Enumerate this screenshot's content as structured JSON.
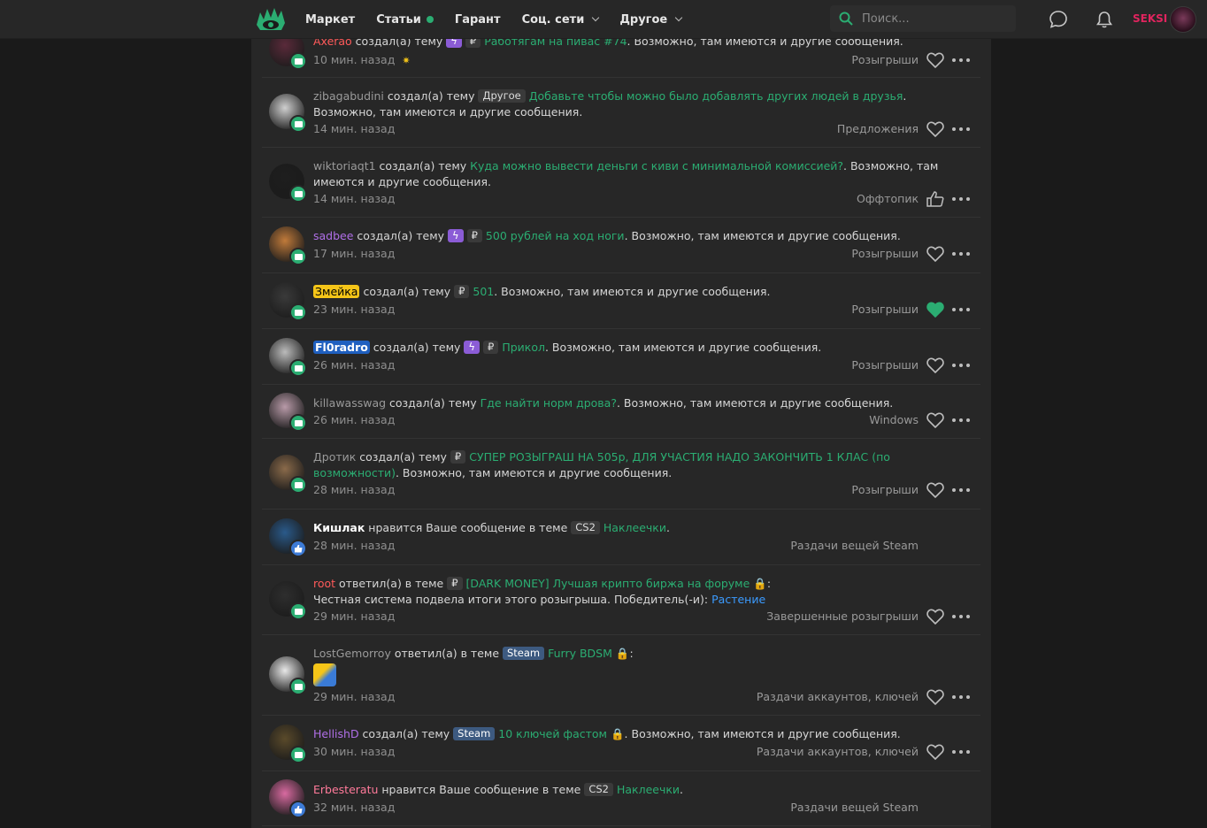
{
  "header": {
    "nav": [
      {
        "label": "Маркет",
        "dot": false,
        "dropdown": false
      },
      {
        "label": "Статьи",
        "dot": true,
        "dropdown": false
      },
      {
        "label": "Гарант",
        "dot": false,
        "dropdown": false
      },
      {
        "label": "Соц. сети",
        "dot": false,
        "dropdown": true
      },
      {
        "label": "Другое",
        "dot": false,
        "dropdown": true
      }
    ],
    "search_placeholder": "Поиск...",
    "username": "SEKSI"
  },
  "alerts": [
    {
      "user": "Axerao",
      "user_style": "red",
      "action": "создал(а) тему",
      "prefixes": [
        "bolt",
        "₽"
      ],
      "title": "Работягам на пивас #74",
      "suffix": ". Возможно, там имеются и другие сообщения.",
      "time": "10 мин. назад",
      "star": true,
      "forum": "Розыгрыши",
      "type": "msg",
      "reaction": "heart"
    },
    {
      "user": "zibagabudini",
      "user_style": "gray",
      "action": "создал(а) тему",
      "prefixes": [
        "Другое"
      ],
      "title": "Добавьте чтобы можно было добавлять других людей в друзья",
      "suffix": ". Возможно, там имеются и другие сообщения.",
      "time": "14 мин. назад",
      "forum": "Предложения",
      "type": "msg",
      "reaction": "heart"
    },
    {
      "user": "wiktoriaqt1",
      "user_style": "gray",
      "action": "создал(а) тему",
      "prefixes": [],
      "title": "Куда можно вывести деньги с киви с минимальной комиссией?",
      "suffix": ". Возможно, там имеются и другие сообщения.",
      "time": "14 мин. назад",
      "forum": "Оффтопик",
      "type": "msg",
      "reaction": "like"
    },
    {
      "user": "sadbee",
      "user_style": "purple",
      "action": "создал(а) тему",
      "prefixes": [
        "bolt",
        "₽"
      ],
      "title": "500 рублей на ход ноги",
      "suffix": ". Возможно, там имеются и другие сообщения.",
      "time": "17 мин. назад",
      "forum": "Розыгрыши",
      "type": "msg",
      "reaction": "heart"
    },
    {
      "user": "Змейка",
      "user_style": "yellow",
      "action": "создал(а) тему",
      "prefixes": [
        "₽"
      ],
      "title": "501",
      "suffix": ". Возможно, там имеются и другие сообщения.",
      "time": "23 мин. назад",
      "forum": "Розыгрыши",
      "type": "msg",
      "reaction": "heart-filled"
    },
    {
      "user": "Fl0radro",
      "user_style": "blue",
      "action": "создал(а) тему",
      "prefixes": [
        "bolt",
        "₽"
      ],
      "title": "Прикол",
      "suffix": ". Возможно, там имеются и другие сообщения.",
      "time": "26 мин. назад",
      "forum": "Розыгрыши",
      "type": "msg",
      "reaction": "heart"
    },
    {
      "user": "killawasswag",
      "user_style": "gray",
      "action": "создал(а) тему",
      "prefixes": [],
      "title": "Где найти норм дрова?",
      "suffix": ". Возможно, там имеются и другие сообщения.",
      "time": "26 мин. назад",
      "forum": "Windows",
      "type": "msg",
      "reaction": "heart"
    },
    {
      "user": "Дротик",
      "user_style": "gray",
      "action": "создал(а) тему",
      "prefixes": [
        "₽"
      ],
      "title": "СУПЕР РОЗЫГРАШ НА 505р, ДЛЯ УЧАСТИЯ НАДО ЗАКОНЧИТЬ 1 КЛАС (по возможности)",
      "suffix": ". Возможно, там имеются и другие сообщения.",
      "time": "28 мин. назад",
      "forum": "Розыгрыши",
      "type": "msg",
      "reaction": "heart"
    },
    {
      "user": "Кишлак",
      "user_style": "white",
      "action": "нравится Ваше сообщение в теме",
      "prefixes": [
        "CS2"
      ],
      "title": "Наклеечки",
      "suffix": ".",
      "time": "28 мин. назад",
      "forum": "Раздачи вещей Steam",
      "type": "like",
      "reaction": "none"
    },
    {
      "user": "root",
      "user_style": "red",
      "action": "ответил(а) в теме",
      "prefixes": [
        "₽"
      ],
      "title": "[DARK MONEY] Лучшая крипто биржа на форуме",
      "lock": true,
      "suffix": ":",
      "body": "Честная система подвела итоги этого розыгрыша. Победитель(-и): ",
      "body_link": "Растение",
      "time": "29 мин. назад",
      "forum": "Завершенные розыгрыши",
      "type": "msg",
      "reaction": "heart"
    },
    {
      "user": "LostGemorroy",
      "user_style": "gray",
      "action": "ответил(а) в теме",
      "prefixes": [
        "Steam"
      ],
      "title": "Furry BDSM",
      "lock": true,
      "suffix": ":",
      "emoji": true,
      "time": "29 мин. назад",
      "forum": "Раздачи аккаунтов, ключей",
      "type": "msg",
      "reaction": "heart"
    },
    {
      "user": "HellishD",
      "user_style": "purple",
      "action": "создал(а) тему",
      "prefixes": [
        "Steam"
      ],
      "title": "10 ключей фастом",
      "lock": true,
      "suffix": ". Возможно, там имеются и другие сообщения.",
      "time": "30 мин. назад",
      "forum": "Раздачи аккаунтов, ключей",
      "type": "msg",
      "reaction": "heart"
    },
    {
      "user": "Erbesteratu",
      "user_style": "pink",
      "action": "нравится Ваше сообщение в теме",
      "prefixes": [
        "CS2"
      ],
      "title": "Наклеечки",
      "suffix": ".",
      "time": "32 мин. назад",
      "forum": "Раздачи вещей Steam",
      "type": "like",
      "reaction": "none"
    }
  ],
  "colors": {
    "accent": "#2bad72",
    "background": "#1a1a1a",
    "panel": "#272727",
    "username_top": "#e0245e"
  }
}
